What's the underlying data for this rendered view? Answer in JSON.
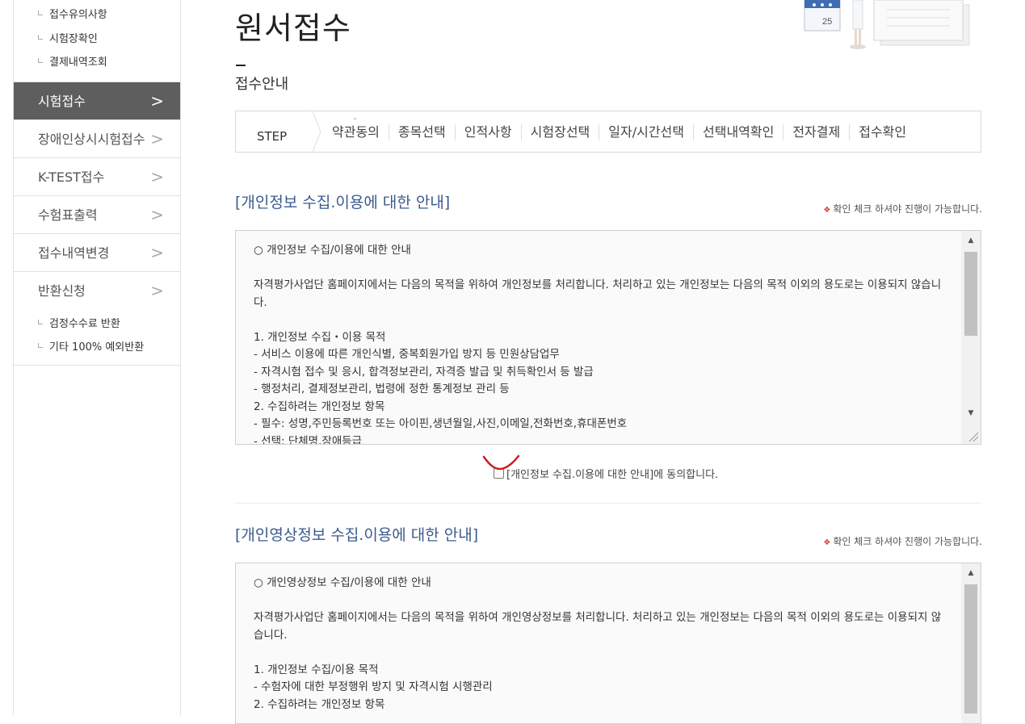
{
  "sidebar": {
    "top_subitems": [
      "접수유의사항",
      "시험장확인",
      "결제내역조회"
    ],
    "menu": [
      {
        "label": "시험접수",
        "active": true
      },
      {
        "label": "장애인상시시험접수",
        "active": false
      },
      {
        "label": "K-TEST접수",
        "active": false
      },
      {
        "label": "수험표출력",
        "active": false
      },
      {
        "label": "접수내역변경",
        "active": false
      },
      {
        "label": "반환신청",
        "active": false
      }
    ],
    "bottom_subitems": [
      "검정수수료 반환",
      "기타 100% 예외반환"
    ],
    "chevron": ">"
  },
  "page": {
    "title": "원서접수",
    "section": "접수안내",
    "calendar_day": "25"
  },
  "steps": {
    "label": "STEP",
    "items": [
      "약관동의",
      "종목선택",
      "인적사항",
      "시험장선택",
      "일자/시간선택",
      "선택내역확인",
      "전자결제",
      "접수확인"
    ],
    "current_marker": "ˇ"
  },
  "privacy": {
    "title": "[개인정보 수집.이용에 대한 안내]",
    "notice": "확인 체크 하셔야 진행이 가능합니다.",
    "notice_mark": "❖",
    "content": "○ 개인정보 수집/이용에 대한 안내\n\n자격평가사업단 홈페이지에서는 다음의 목적을 위하여 개인정보를 처리합니다. 처리하고 있는 개인정보는 다음의 목적 이외의 용도로는 이용되지 않습니다.\n\n1. 개인정보 수집・이용 목적\n- 서비스 이용에 따른 개인식별, 중복회원가입 방지 등 민원상담업무\n- 자격시험 접수 및 응시, 합격정보관리, 자격증 발급 및 취득확인서 등 발급\n- 행정처리, 결제정보관리, 법령에 정한 통계정보 관리 등\n2. 수집하려는 개인정보 항목\n- 필수: 성명,주민등록번호 또는 아이핀,생년월일,사진,이메일,전화번호,휴대폰번호\n- 선택: 단체명,장애등급",
    "agree_label": "[개인정보 수집.이용에 대한 안내]에 동의합니다."
  },
  "video": {
    "title": "[개인영상정보 수집.이용에 대한 안내]",
    "notice": "확인 체크 하셔야 진행이 가능합니다.",
    "notice_mark": "❖",
    "content": "○ 개인영상정보 수집/이용에 대한 안내\n\n자격평가사업단 홈페이지에서는 다음의 목적을 위하여 개인영상정보를 처리합니다. 처리하고 있는 개인정보는 다음의 목적 이외의 용도로는 이용되지 않습니다.\n\n1. 개인정보 수집/이용 목적\n- 수험자에 대한 부정행위 방지 및 자격시험 시행관리\n2. 수집하려는 개인정보 항목"
  },
  "colors": {
    "active_menu_bg": "#5e5e5e",
    "block_title": "#3b5a8e",
    "annotation": "#cc1f1f"
  }
}
